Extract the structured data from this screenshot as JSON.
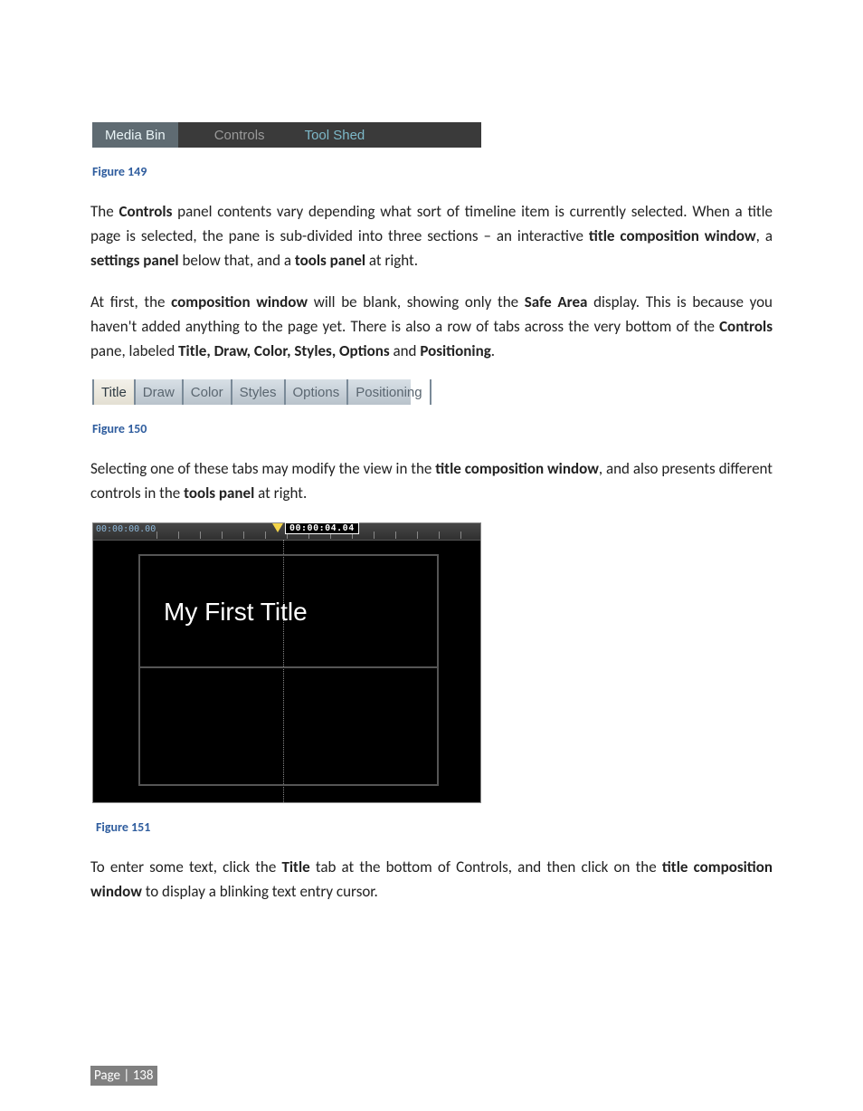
{
  "figure149": {
    "label": "Figure 149",
    "tabs": [
      "Media Bin",
      "Controls",
      "Tool Shed"
    ]
  },
  "para1_html": "The <b>Controls</b> panel contents vary depending what sort of timeline item is currently selected. When a title page is selected, the pane is sub-divided into three sections – an interactive <b>title composition window</b>, a <b>settings panel</b> below that, and a <b>tools panel</b> at right.",
  "para2_html": "At first, the <b>composition window</b> will be blank, showing only the <b>Safe Area</b> display.  This is because you haven't added anything to the page yet.  There is also a row of tabs across the very bottom of the <b>Controls</b> pane, labeled <b>Title, Draw, Color, Styles, Options</b> and <b>Positioning</b>.",
  "figure150": {
    "label": "Figure 150",
    "tabs": [
      "Title",
      "Draw",
      "Color",
      "Styles",
      "Options",
      "Positioning"
    ]
  },
  "para3_html": "Selecting one of these tabs may modify the view in the <b>title composition window</b>, and also presents different controls in the <b>tools panel</b> at right.",
  "figure151": {
    "label": "Figure 151",
    "timecode_start": "00:00:00.00",
    "timecode_current": "00:00:04.04",
    "title_text": "My First Title"
  },
  "para4_html": "To enter some text, click the <b>Title</b> tab at the bottom of Controls, and then click on the <b>title composition window</b> to display a blinking text entry cursor.",
  "footer": "Page | 138"
}
